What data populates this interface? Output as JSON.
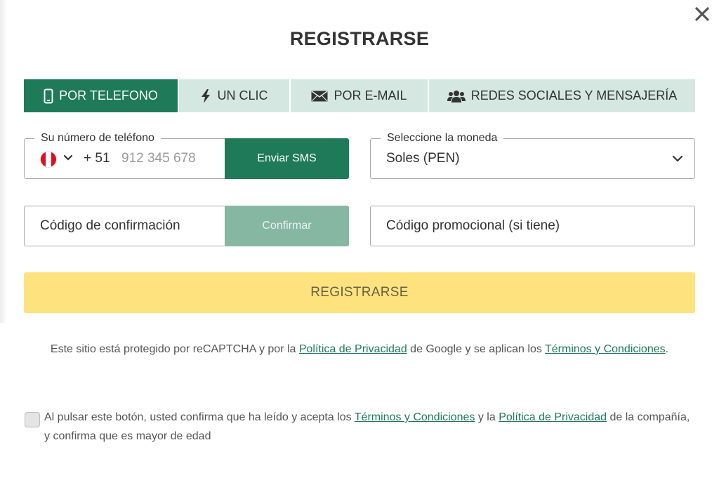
{
  "modal": {
    "title": "REGISTRARSE",
    "close_icon": "close-icon"
  },
  "tabs": [
    {
      "label": "POR TELEFONO",
      "icon": "phone-icon",
      "active": true
    },
    {
      "label": "UN CLIC",
      "icon": "lightning-icon",
      "active": false
    },
    {
      "label": "POR E-MAIL",
      "icon": "envelope-icon",
      "active": false
    },
    {
      "label": "REDES SOCIALES Y MENSAJERÍA",
      "icon": "users-icon",
      "active": false
    }
  ],
  "phone": {
    "legend": "Su número de teléfono",
    "country_flag": "peru-flag-icon",
    "prefix": "+ 51",
    "placeholder": "912 345 678",
    "send_sms_label": "Enviar SMS"
  },
  "currency": {
    "legend": "Seleccione la moneda",
    "selected": "Soles (PEN)"
  },
  "confirmation": {
    "placeholder": "Código de confirmación",
    "confirm_label": "Confirmar"
  },
  "promo": {
    "placeholder": "Código promocional (si tiene)"
  },
  "register_button": "REGISTRARSE",
  "recaptcha": {
    "text_1": "Este sitio está protegido por reCAPTCHA y por la ",
    "privacy_link": "Política de Privacidad",
    "text_2": " de Google y se aplican los ",
    "terms_link": "Términos y Condiciones",
    "text_3": "."
  },
  "consent": {
    "text_1": "Al pulsar este botón, usted confirma que ha leído y acepta los ",
    "terms_link": "Términos y Condiciones",
    "text_2": " y la ",
    "privacy_link": "Política de Privacidad",
    "text_3": " de la compañía, y confirma que es mayor de edad",
    "checked": false
  },
  "colors": {
    "primary_green": "#1f7a5a",
    "tab_bg": "#d4e8e1",
    "confirm_disabled": "#86b7a2",
    "register_yellow": "#fee27e",
    "link_green": "#1f7a5a"
  }
}
